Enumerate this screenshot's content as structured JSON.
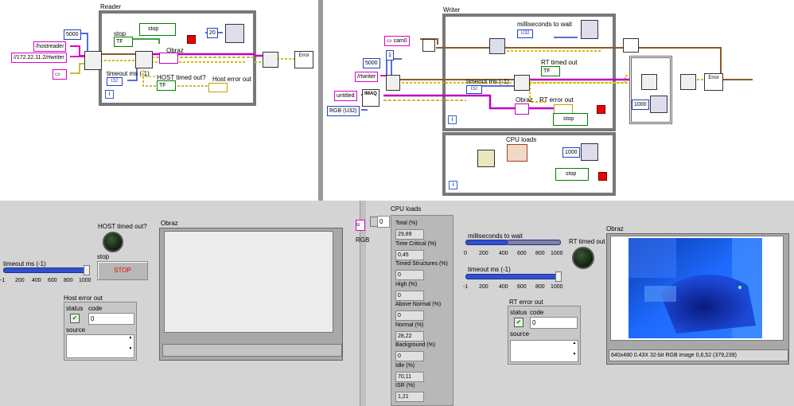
{
  "reader": {
    "title": "Reader",
    "const_5000": "5000",
    "hostreader": "/hostreader",
    "rtwriter_url": "//172.22.11.2/rtwriter",
    "stop_label": "stop",
    "stop_ind": "TF",
    "stop_local": "stop",
    "wait_20": "20",
    "obraz": "Obraz",
    "timeout_label": "timeout ms (-1)",
    "timeout_type": "I32",
    "host_timed_out": "HOST timed out?",
    "host_tf": "TF",
    "host_error_out": "Host error out",
    "iter": "i"
  },
  "writer": {
    "title": "Writer",
    "cam0": "cam0",
    "ms_wait_label": "milliseconds to wait",
    "ms_wait_type": "U32",
    "const_5000": "5000",
    "const_1": "1",
    "rtwriter": "/rtwriter",
    "rt_timed_out": "RT timed out",
    "rt_tf": "TF",
    "timeout_label": "timeout ms (-1)",
    "timeout_type": "I32",
    "untitled": "untitled",
    "imaq": "IMAQ",
    "rgb": "RGB (U32)",
    "obraz": "Obraz",
    "rt_error_out": "RT error out",
    "stop_local": "stop",
    "const_1000": "1000",
    "iter": "i"
  },
  "cpu_block": {
    "title": "CPU loads",
    "const_1000": "1000",
    "stop_local": "stop",
    "iter": "i"
  },
  "fp_left": {
    "host_timed_out": "HOST timed out?",
    "obraz": "Obraz",
    "stop_label": "stop",
    "stop_btn": "STOP",
    "timeout_label": "timeout ms (-1)",
    "ticks": [
      "-1",
      "200",
      "400",
      "600",
      "800",
      "1000"
    ],
    "host_error_out": "Host error out",
    "status": "status",
    "code": "code",
    "code_val": "0",
    "source": "source"
  },
  "fp_right": {
    "index_val": "0",
    "u_label": "u",
    "rgb_label": "RGB",
    "cpu_loads": "CPU loads",
    "cpu": [
      {
        "label": "Total (%)",
        "value": "29,89"
      },
      {
        "label": "Time Critical (%)",
        "value": "0,45"
      },
      {
        "label": "Timed Structures (%)",
        "value": "0"
      },
      {
        "label": "High (%)",
        "value": "0"
      },
      {
        "label": "Above Normal (%)",
        "value": "0"
      },
      {
        "label": "Normal (%)",
        "value": "28,22"
      },
      {
        "label": "Background (%)",
        "value": "0"
      },
      {
        "label": "Idle (%)",
        "value": "70,11"
      },
      {
        "label": "ISR (%)",
        "value": "1,21"
      }
    ],
    "ms_wait_label": "milliseconds to wait",
    "ms_ticks": [
      "0",
      "200",
      "400",
      "600",
      "800",
      "1000"
    ],
    "timeout_label": "timeout ms (-1)",
    "to_ticks": [
      "-1",
      "200",
      "400",
      "600",
      "800",
      "1000"
    ],
    "rt_timed_out": "RT timed out",
    "obraz": "Obraz",
    "rt_error_out": "RT error out",
    "status": "status",
    "code": "code",
    "code_val": "0",
    "source": "source",
    "image_info": "640x480 0.43X 32-bit RGB image 0,6,52    (379,239)"
  }
}
